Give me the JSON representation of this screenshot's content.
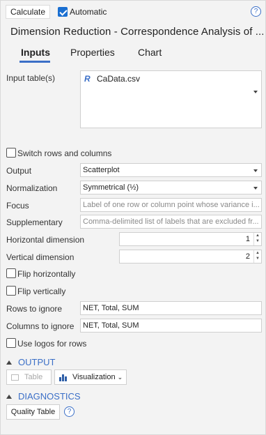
{
  "toolbar": {
    "calculate_label": "Calculate",
    "automatic_label": "Automatic",
    "automatic_checked": true,
    "help_glyph": "?"
  },
  "title": "Dimension Reduction - Correspondence Analysis of ...",
  "tabs": [
    {
      "label": "Inputs",
      "active": true
    },
    {
      "label": "Properties",
      "active": false
    },
    {
      "label": "Chart",
      "active": false
    }
  ],
  "inputs": {
    "input_table_label": "Input table(s)",
    "input_table_item": "CaData.csv",
    "input_table_icon": "R",
    "switch_rows_label": "Switch rows and columns",
    "output_label": "Output",
    "output_value": "Scatterplot",
    "normalization_label": "Normalization",
    "normalization_value": "Symmetrical (½)",
    "focus_label": "Focus",
    "focus_placeholder": "Label of one row or column point whose variance i...",
    "supplementary_label": "Supplementary",
    "supplementary_placeholder": "Comma-delimited list of labels that are excluded fr...",
    "horizontal_label": "Horizontal dimension",
    "horizontal_value": "1",
    "vertical_label": "Vertical dimension",
    "vertical_value": "2",
    "flip_h_label": "Flip horizontally",
    "flip_v_label": "Flip vertically",
    "rows_ignore_label": "Rows to ignore",
    "rows_ignore_value": "NET, Total, SUM",
    "cols_ignore_label": "Columns to ignore",
    "cols_ignore_value": "NET, Total, SUM",
    "logos_label": "Use logos for rows"
  },
  "output_section": {
    "heading": "OUTPUT",
    "table_button": "Table",
    "visualization_button": "Visualization",
    "visualization_caret": "⌄"
  },
  "diagnostics_section": {
    "heading": "DIAGNOSTICS",
    "quality_table_button": "Quality Table",
    "help_glyph": "?"
  },
  "colors": {
    "accent": "#3b6fc7",
    "background": "#f3f3f3",
    "checkbox_checked": "#1a6fd1"
  }
}
